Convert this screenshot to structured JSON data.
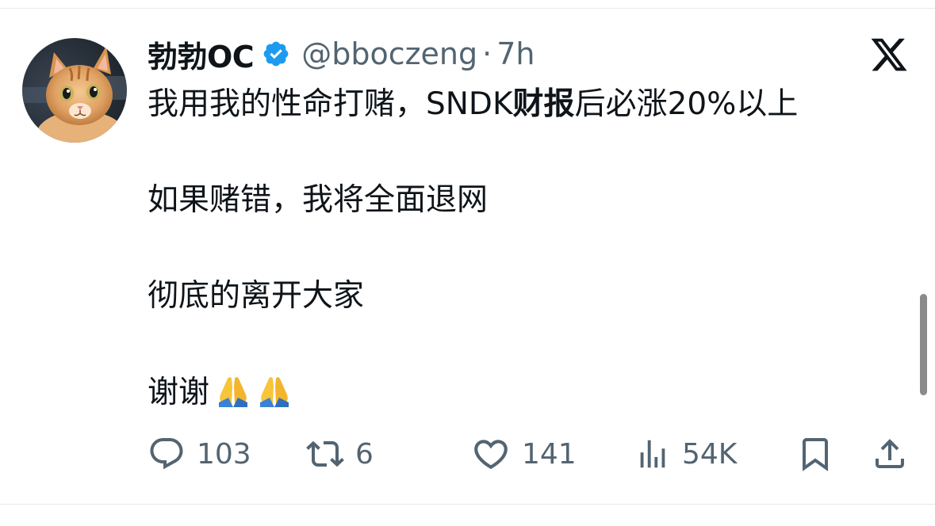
{
  "author": {
    "display_name": "勃勃OC",
    "handle": "@bboczeng",
    "separator": "·",
    "time": "7h",
    "verified": true,
    "avatar_icon": "orange-tabby-cat-avatar"
  },
  "platform_icon": "x-logo-icon",
  "tweet": {
    "line1": {
      "pre": "我用我的性命打赌，SNDK",
      "bold": "财报",
      "post": "后必涨20%以上"
    },
    "line2": "如果赌错，我将全面退网",
    "line3": "彻底的离开大家",
    "line4": "谢谢",
    "emoji": [
      "folded-hands-emoji",
      "folded-hands-emoji"
    ]
  },
  "actions": {
    "reply": {
      "icon": "reply-icon",
      "count": "103"
    },
    "retweet": {
      "icon": "retweet-icon",
      "count": "6"
    },
    "like": {
      "icon": "heart-icon",
      "count": "141"
    },
    "views": {
      "icon": "views-icon",
      "count": "54K"
    },
    "bookmark": {
      "icon": "bookmark-icon"
    },
    "share": {
      "icon": "share-icon"
    }
  },
  "colors": {
    "text": "#0f1419",
    "secondary": "#536471",
    "verified": "#1d9bf0",
    "separator": "#e7e9ea"
  }
}
